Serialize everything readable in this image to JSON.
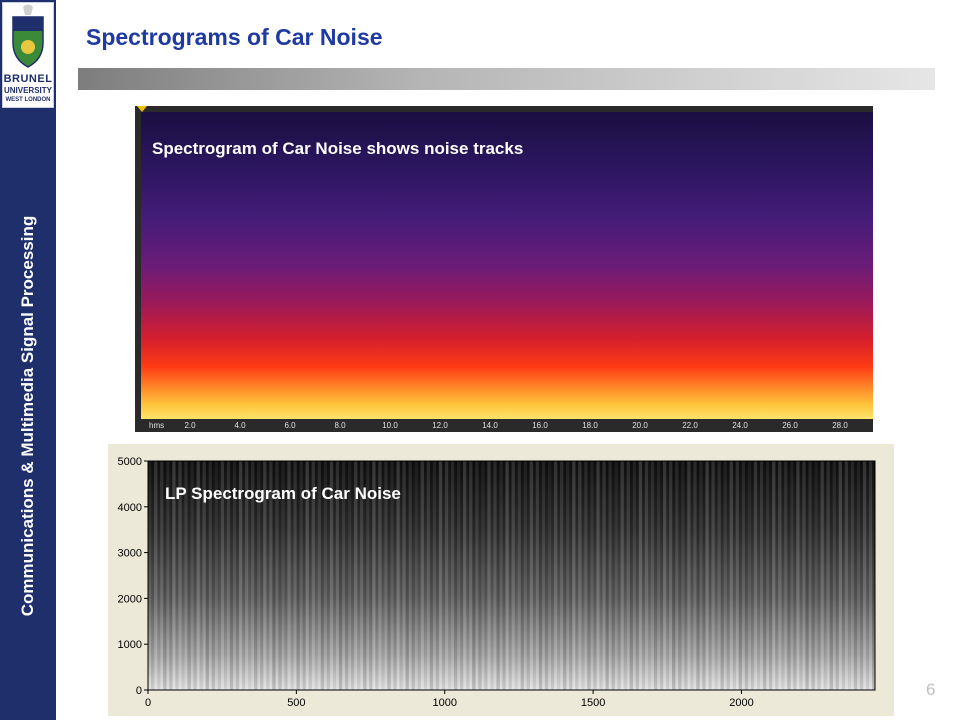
{
  "logo": {
    "line1": "BRUNEL",
    "line2": "UNIVERSITY",
    "line3": "WEST LONDON"
  },
  "sidebar": {
    "vertical_title": "Communications & Multimedia Signal Processing"
  },
  "slide": {
    "title": "Spectrograms of Car Noise",
    "page_number": "6"
  },
  "spectrogram_top": {
    "caption": "Spectrogram of Car Noise shows noise tracks",
    "axis_unit": "hms",
    "ticks": [
      "2.0",
      "4.0",
      "6.0",
      "8.0",
      "10.0",
      "12.0",
      "14.0",
      "16.0",
      "18.0",
      "20.0",
      "22.0",
      "24.0",
      "26.0",
      "28.0"
    ]
  },
  "chart_data": {
    "type": "heatmap",
    "title": "",
    "caption": "LP Spectrogram of Car Noise",
    "xlabel": "",
    "ylabel": "",
    "xlim": [
      0,
      2450
    ],
    "ylim": [
      0,
      5000
    ],
    "x_ticks": [
      0,
      500,
      1000,
      1500,
      2000
    ],
    "y_ticks": [
      0,
      1000,
      2000,
      3000,
      4000,
      5000
    ],
    "colormap": "gray"
  },
  "colors": {
    "sidebar": "#1f2f6b",
    "title": "#1f3aa0"
  }
}
